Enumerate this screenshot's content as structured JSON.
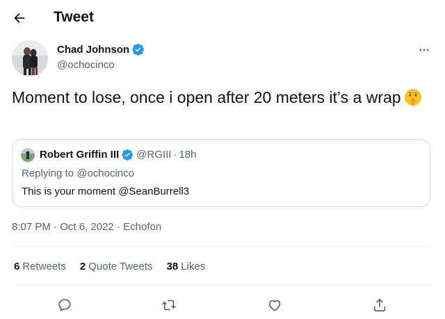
{
  "header": {
    "title": "Tweet",
    "back_icon": "arrow-left-icon"
  },
  "author": {
    "name": "Chad Johnson",
    "handle": "@ochocinco",
    "verified": true,
    "verified_color": "#1d9bf0",
    "more_icon": "more-horizontal-icon"
  },
  "tweet": {
    "text": "Moment to lose, once i open after 20 meters it’s a wrap",
    "emoji": "shushing-face-emoji"
  },
  "quote": {
    "name": "Robert Griffin III",
    "handle": "@RGIII",
    "separator": "·",
    "time": "18h",
    "replying_prefix": "Replying to",
    "replying_to": "@ochocinco",
    "text": "This is your moment @SeanBurrell3"
  },
  "meta": {
    "time": "8:07 PM",
    "sep1": " · ",
    "date": "Oct 6, 2022",
    "sep2": " · ",
    "source": "Echofon"
  },
  "stats": {
    "retweets_count": "6",
    "retweets_label": "Retweets",
    "quotes_count": "2",
    "quotes_label": "Quote Tweets",
    "likes_count": "38",
    "likes_label": "Likes"
  },
  "actions": {
    "reply_icon": "reply-icon",
    "retweet_icon": "retweet-icon",
    "like_icon": "heart-icon",
    "share_icon": "share-icon",
    "icon_color": "#536471"
  }
}
